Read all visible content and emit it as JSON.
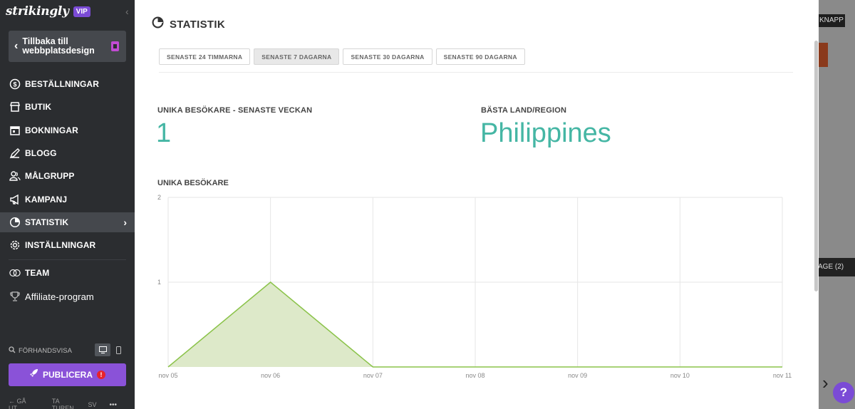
{
  "sidebar": {
    "brand": "strikingly",
    "vip": "VIP",
    "back_label": "Tillbaka till webbplatsdesign",
    "items": [
      {
        "label": "BESTÄLLNINGAR",
        "icon": "dollar-circle-icon"
      },
      {
        "label": "BUTIK",
        "icon": "store-icon"
      },
      {
        "label": "BOKNINGAR",
        "icon": "calendar-icon"
      },
      {
        "label": "BLOGG",
        "icon": "pen-icon"
      },
      {
        "label": "MÅLGRUPP",
        "icon": "people-icon"
      },
      {
        "label": "KAMPANJ",
        "icon": "megaphone-icon"
      },
      {
        "label": "STATISTIK",
        "icon": "pie-chart-icon",
        "active": true
      },
      {
        "label": "INSTÄLLNINGAR",
        "icon": "gear-icon"
      },
      {
        "label": "TEAM",
        "icon": "team-icon"
      },
      {
        "label": "Affiliate-program",
        "icon": "trophy-icon"
      }
    ],
    "preview_label": "FÖRHANDSVISA",
    "publish_label": "PUBLICERA",
    "footer": {
      "exit": "GÅ UT",
      "tour": "TA TUREN",
      "lang": "SV",
      "more": "•••"
    }
  },
  "background": {
    "button1": "KNAPP",
    "button2": "AGE (2)"
  },
  "panel": {
    "title": "STATISTIK",
    "tabs": [
      "SENASTE 24 TIMMARNA",
      "SENASTE 7 DAGARNA",
      "SENASTE 30 DAGARNA",
      "SENASTE 90 DAGARNA"
    ],
    "active_tab": 1,
    "unique_visitors_label": "UNIKA BESÖKARE - SENASTE VECKAN",
    "unique_visitors_value": "1",
    "top_country_label": "BÄSTA LAND/REGION",
    "top_country_value": "Philippines",
    "chart_title": "UNIKA BESÖKARE"
  },
  "chart_data": {
    "type": "area",
    "title": "UNIKA BESÖKARE",
    "x": [
      "nov 05",
      "nov 06",
      "nov 07",
      "nov 08",
      "nov 09",
      "nov 10",
      "nov 11"
    ],
    "values": [
      0,
      1,
      0,
      0,
      0,
      0,
      0
    ],
    "ylim": [
      0,
      2
    ],
    "yticks": [
      1,
      2
    ],
    "grid": true,
    "fill": "#dde9c9",
    "stroke": "#8bc34a"
  },
  "colors": {
    "accent": "#8a52d8",
    "stat_value": "#45b6a4",
    "sidebar_bg": "#2b2d30"
  }
}
